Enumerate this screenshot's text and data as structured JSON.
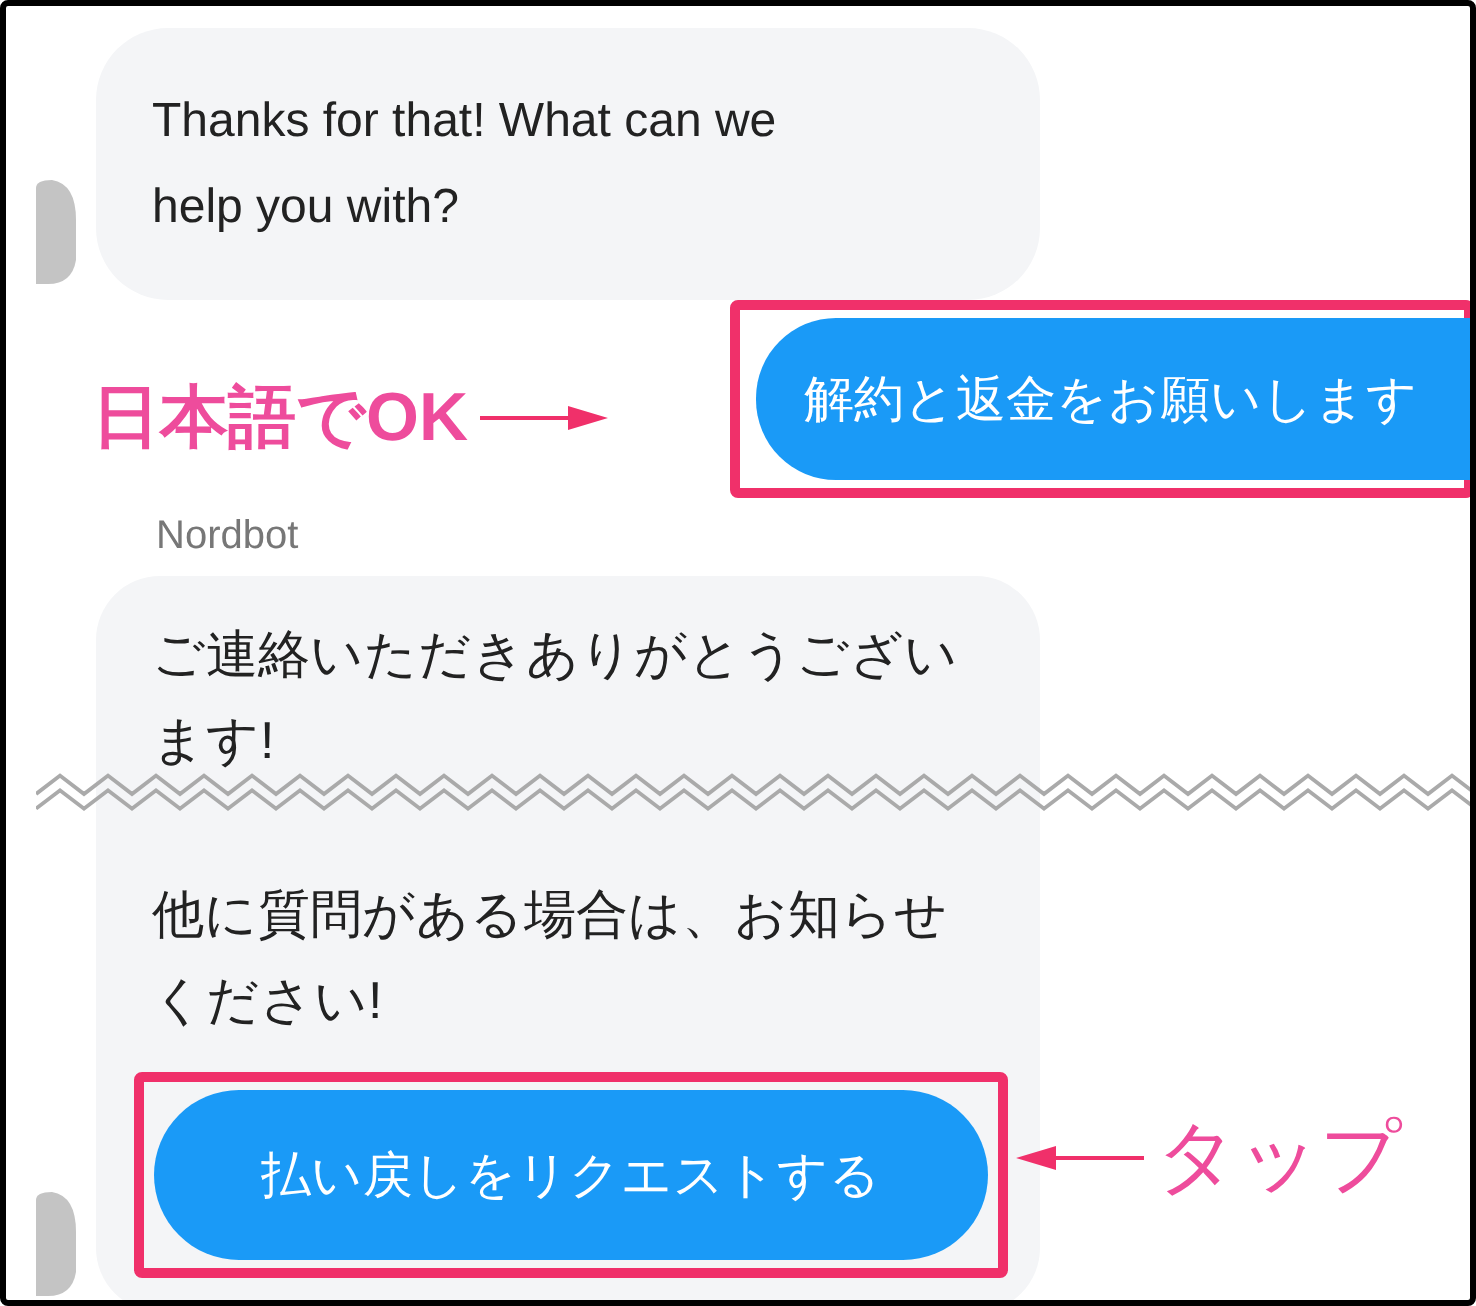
{
  "messages": [
    {
      "kind": "bot_text",
      "lines": [
        "Thanks for that! What can we help you with?"
      ]
    },
    {
      "kind": "user_reply",
      "text": "解約と返金をお願いします",
      "highlighted": true,
      "note": "日本語でOK"
    },
    {
      "kind": "sender",
      "text": "Nordbot"
    },
    {
      "kind": "bot_card",
      "paragraphs": [
        "ご連絡いただきありがとうございます!",
        "他に質問がある場合は、お知らせください!"
      ],
      "button": {
        "text": "払い戻しをリクエストする",
        "highlighted": true,
        "note": "タップ"
      },
      "torn": true
    }
  ]
}
